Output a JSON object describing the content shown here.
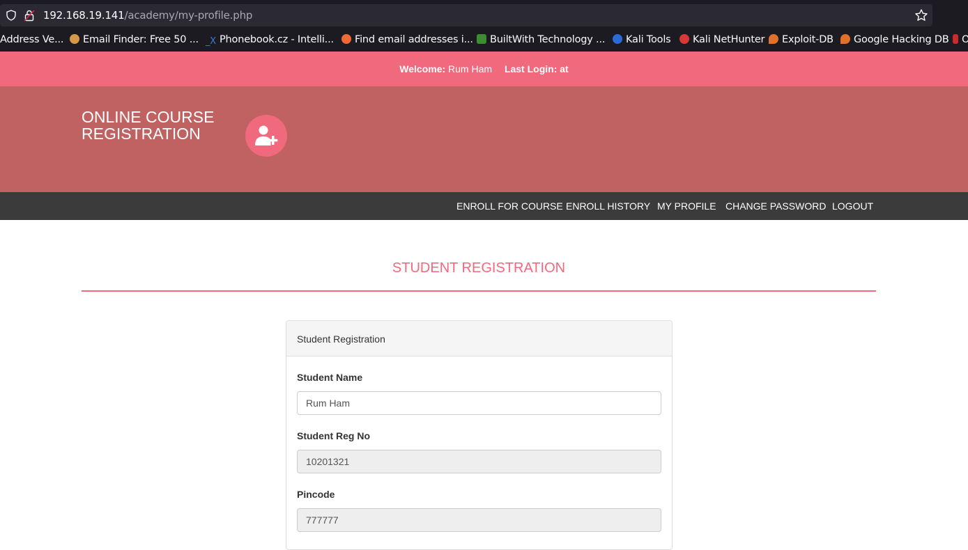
{
  "browser": {
    "url_host": "192.168.19.141",
    "url_path": "/academy/my-profile.php",
    "bookmarks": [
      {
        "label": "Address Ve...",
        "icon": "globe-icon",
        "color": "#1c1b22"
      },
      {
        "label": "Email Finder: Free 50 ...",
        "icon": "email-finder-icon",
        "color": "#d49a4a"
      },
      {
        "label": "Phonebook.cz - Intelli...",
        "icon": "phonebook-icon",
        "color": "#3a7bd5"
      },
      {
        "label": "Find email addresses i...",
        "icon": "hunter-icon",
        "color": "#f06a35"
      },
      {
        "label": "BuiltWith Technology ...",
        "icon": "builtwith-icon",
        "color": "#3c8d2f"
      },
      {
        "label": "Kali Tools",
        "icon": "kali-tools-icon",
        "color": "#2a6bd9"
      },
      {
        "label": "Kali NetHunter",
        "icon": "kali-nethunter-icon",
        "color": "#d93838"
      },
      {
        "label": "Exploit-DB",
        "icon": "exploit-db-icon",
        "color": "#e0702a"
      },
      {
        "label": "Google Hacking DB",
        "icon": "ghdb-icon",
        "color": "#e0702a"
      },
      {
        "label": "O",
        "icon": "offsec-icon",
        "color": "#c92a2a"
      }
    ]
  },
  "topbar": {
    "welcome_label": "Welcome:",
    "welcome_name": "Rum Ham",
    "last_login_label": "Last Login:",
    "last_login_value": "at"
  },
  "brand": {
    "title": "ONLINE COURSE REGISTRATION",
    "icon": "user-plus-icon"
  },
  "nav": {
    "items": [
      "ENROLL FOR COURSE",
      "ENROLL HISTORY",
      "MY PROFILE",
      "CHANGE PASSWORD",
      "LOGOUT"
    ]
  },
  "main": {
    "heading": "STUDENT REGISTRATION",
    "panel_title": "Student Registration",
    "fields": [
      {
        "label": "Student Name",
        "value": "Rum Ham",
        "readonly": false
      },
      {
        "label": "Student Reg No",
        "value": "10201321",
        "readonly": true
      },
      {
        "label": "Pincode",
        "value": "777777",
        "readonly": true
      }
    ]
  },
  "colors": {
    "accent": "#f1697c",
    "banner": "#c06262",
    "navbar": "#3b3b3b"
  }
}
